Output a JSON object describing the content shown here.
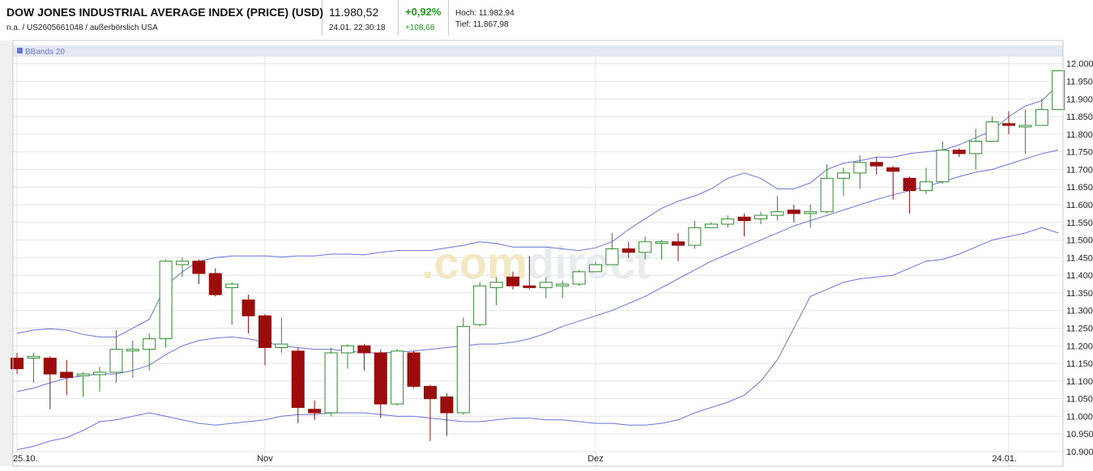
{
  "header": {
    "title": "DOW JONES INDUSTRIAL AVERAGE INDEX (PRICE) (USD)",
    "subtitle": "n.a. / US2605661048 / außerbörslich USA",
    "price": "11.980,52",
    "timestamp": "24.01. 22:30:18",
    "change_pct": "+0,92%",
    "change_abs": "+108,68",
    "high": "Hoch: 11.982,94",
    "low": "Tief: 11.867,98"
  },
  "watermark": {
    "part1": ".com",
    "part2": "direct"
  },
  "colors": {
    "up": "#2e8b2e",
    "down": "#9b0c0c",
    "band": "#6b74d6",
    "grid": "#e4e4e4",
    "legend_bar": "#e3e8f4"
  },
  "chart_data": {
    "type": "candlestick",
    "title": "",
    "legend": [
      "BBands 20"
    ],
    "ylim": [
      10900,
      12020
    ],
    "y_ticks": [
      12000,
      11950,
      11900,
      11850,
      11800,
      11750,
      11700,
      11650,
      11600,
      11550,
      11500,
      11450,
      11400,
      11350,
      11300,
      11250,
      11200,
      11150,
      11100,
      11050,
      11000,
      10950,
      10900
    ],
    "y_tick_labels": [
      "12.000",
      "11.950",
      "11.900",
      "11.850",
      "11.800",
      "11.750",
      "11.700",
      "11.650",
      "11.600",
      "11.550",
      "11.500",
      "11.450",
      "11.400",
      "11.350",
      "11.300",
      "11.250",
      "11.200",
      "11.150",
      "11.100",
      "11.050",
      "11.000",
      "10.950",
      "10.900"
    ],
    "x_tick_labels": [
      {
        "label": "25.10.",
        "index": 0
      },
      {
        "label": "Nov",
        "index": 15
      },
      {
        "label": "Dez",
        "index": 35
      },
      {
        "label": "24.01.",
        "index": 60
      }
    ],
    "candles": [
      [
        11165,
        11180,
        11120,
        11135
      ],
      [
        11165,
        11180,
        11095,
        11170
      ],
      [
        11165,
        11170,
        11020,
        11120
      ],
      [
        11125,
        11160,
        11060,
        11110
      ],
      [
        11115,
        11125,
        11055,
        11120
      ],
      [
        11118,
        11140,
        11070,
        11125
      ],
      [
        11125,
        11245,
        11095,
        11190
      ],
      [
        11190,
        11215,
        11110,
        11190
      ],
      [
        11190,
        11235,
        11130,
        11220
      ],
      [
        11220,
        11445,
        11195,
        11440
      ],
      [
        11430,
        11450,
        11395,
        11440
      ],
      [
        11440,
        11445,
        11375,
        11405
      ],
      [
        11405,
        11420,
        11340,
        11345
      ],
      [
        11365,
        11380,
        11260,
        11375
      ],
      [
        11330,
        11345,
        11235,
        11285
      ],
      [
        11285,
        11290,
        11145,
        11195
      ],
      [
        11195,
        11280,
        11180,
        11205
      ],
      [
        11185,
        11195,
        10980,
        11025
      ],
      [
        11020,
        11045,
        10990,
        11010
      ],
      [
        11010,
        11195,
        11000,
        11180
      ],
      [
        11180,
        11205,
        11135,
        11200
      ],
      [
        11200,
        11205,
        11130,
        11180
      ],
      [
        11180,
        11190,
        10995,
        11035
      ],
      [
        11035,
        11190,
        11030,
        11185
      ],
      [
        11180,
        11185,
        11080,
        11085
      ],
      [
        11085,
        11090,
        10930,
        11050
      ],
      [
        11055,
        11065,
        10945,
        11010
      ],
      [
        11010,
        11280,
        11005,
        11255
      ],
      [
        11260,
        11380,
        11255,
        11370
      ],
      [
        11365,
        11395,
        11315,
        11380
      ],
      [
        11395,
        11410,
        11360,
        11370
      ],
      [
        11370,
        11455,
        11360,
        11365
      ],
      [
        11365,
        11395,
        11335,
        11380
      ],
      [
        11370,
        11385,
        11335,
        11375
      ],
      [
        11375,
        11415,
        11370,
        11410
      ],
      [
        11410,
        11440,
        11410,
        11430
      ],
      [
        11430,
        11520,
        11430,
        11475
      ],
      [
        11475,
        11495,
        11450,
        11465
      ],
      [
        11465,
        11510,
        11445,
        11495
      ],
      [
        11495,
        11500,
        11445,
        11495
      ],
      [
        11495,
        11520,
        11440,
        11485
      ],
      [
        11485,
        11555,
        11475,
        11535
      ],
      [
        11535,
        11550,
        11540,
        11545
      ],
      [
        11545,
        11570,
        11535,
        11560
      ],
      [
        11565,
        11575,
        11510,
        11555
      ],
      [
        11560,
        11580,
        11545,
        11570
      ],
      [
        11570,
        11625,
        11555,
        11580
      ],
      [
        11585,
        11600,
        11550,
        11575
      ],
      [
        11575,
        11600,
        11535,
        11580
      ],
      [
        11580,
        11715,
        11575,
        11675
      ],
      [
        11675,
        11705,
        11625,
        11690
      ],
      [
        11690,
        11740,
        11645,
        11720
      ],
      [
        11720,
        11735,
        11685,
        11710
      ],
      [
        11705,
        11710,
        11615,
        11695
      ],
      [
        11675,
        11680,
        11575,
        11640
      ],
      [
        11640,
        11705,
        11630,
        11665
      ],
      [
        11665,
        11780,
        11660,
        11755
      ],
      [
        11755,
        11760,
        11735,
        11745
      ],
      [
        11745,
        11815,
        11700,
        11780
      ],
      [
        11780,
        11850,
        11780,
        11835
      ],
      [
        11830,
        11865,
        11800,
        11825
      ],
      [
        11825,
        11870,
        11745,
        11825
      ],
      [
        11825,
        11900,
        11830,
        11870
      ],
      [
        11870,
        11982,
        11868,
        11980
      ]
    ],
    "bbands": {
      "period": 20,
      "upper": [
        11235,
        11245,
        11248,
        11245,
        11232,
        11225,
        11225,
        11250,
        11275,
        11370,
        11410,
        11440,
        11450,
        11455,
        11455,
        11455,
        11452,
        11455,
        11455,
        11460,
        11460,
        11458,
        11465,
        11470,
        11470,
        11470,
        11478,
        11485,
        11495,
        11490,
        11480,
        11480,
        11480,
        11475,
        11470,
        11478,
        11495,
        11530,
        11560,
        11590,
        11610,
        11625,
        11645,
        11675,
        11690,
        11675,
        11645,
        11645,
        11662,
        11700,
        11718,
        11725,
        11735,
        11735,
        11745,
        11750,
        11755,
        11770,
        11790,
        11810,
        11850,
        11880,
        11895,
        11940
      ],
      "middle": [
        11070,
        11080,
        11095,
        11108,
        11115,
        11120,
        11120,
        11130,
        11145,
        11175,
        11200,
        11215,
        11222,
        11225,
        11220,
        11210,
        11200,
        11195,
        11190,
        11190,
        11185,
        11180,
        11180,
        11182,
        11185,
        11190,
        11195,
        11200,
        11205,
        11205,
        11210,
        11220,
        11235,
        11255,
        11270,
        11285,
        11300,
        11320,
        11340,
        11365,
        11390,
        11415,
        11440,
        11460,
        11480,
        11500,
        11520,
        11540,
        11555,
        11570,
        11585,
        11600,
        11615,
        11628,
        11640,
        11652,
        11665,
        11680,
        11692,
        11700,
        11715,
        11730,
        11745,
        11755
      ],
      "lower": [
        10905,
        10915,
        10930,
        10940,
        10960,
        10985,
        10990,
        11000,
        11010,
        11000,
        10990,
        10980,
        10975,
        10980,
        10985,
        10990,
        11000,
        11005,
        11005,
        11010,
        11010,
        11010,
        11005,
        11000,
        11000,
        10995,
        10990,
        10985,
        10985,
        10990,
        10995,
        10995,
        10990,
        10990,
        10985,
        10980,
        10980,
        10975,
        10975,
        10980,
        10990,
        11010,
        11025,
        11040,
        11060,
        11100,
        11160,
        11250,
        11340,
        11360,
        11380,
        11390,
        11395,
        11400,
        11420,
        11440,
        11445,
        11460,
        11480,
        11500,
        11510,
        11520,
        11535,
        11520
      ]
    }
  }
}
